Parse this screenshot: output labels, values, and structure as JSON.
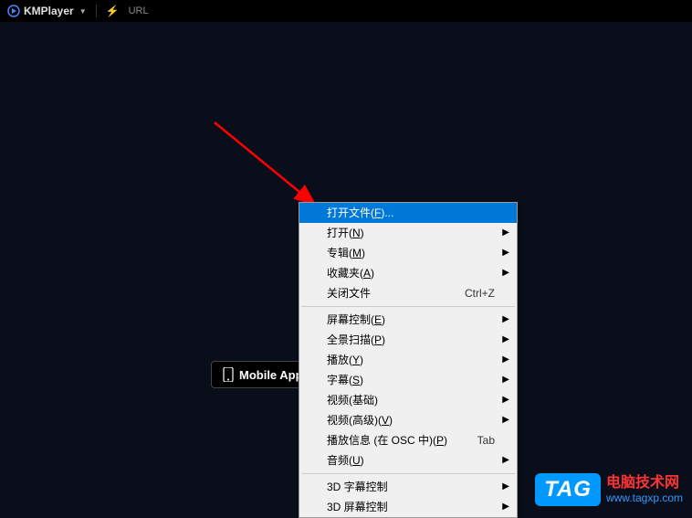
{
  "titlebar": {
    "app_name": "KMPlayer",
    "url_label": "URL"
  },
  "mobile_app_button": {
    "label": "Mobile App"
  },
  "context_menu": {
    "items": [
      {
        "label_pre": "打开文件(",
        "mnemonic": "F",
        "label_post": ")...",
        "type": "item",
        "highlighted": true
      },
      {
        "label_pre": "打开(",
        "mnemonic": "N",
        "label_post": ")",
        "type": "submenu"
      },
      {
        "label_pre": "专辑(",
        "mnemonic": "M",
        "label_post": ")",
        "type": "submenu"
      },
      {
        "label_pre": "收藏夹(",
        "mnemonic": "A",
        "label_post": ")",
        "type": "submenu"
      },
      {
        "label_pre": "关闭文件",
        "mnemonic": "",
        "label_post": "",
        "type": "item",
        "shortcut": "Ctrl+Z"
      },
      {
        "type": "separator"
      },
      {
        "label_pre": "屏幕控制(",
        "mnemonic": "E",
        "label_post": ")",
        "type": "submenu"
      },
      {
        "label_pre": "全景扫描(",
        "mnemonic": "P",
        "label_post": ")",
        "type": "submenu"
      },
      {
        "label_pre": "播放(",
        "mnemonic": "Y",
        "label_post": ")",
        "type": "submenu"
      },
      {
        "label_pre": "字幕(",
        "mnemonic": "S",
        "label_post": ")",
        "type": "submenu"
      },
      {
        "label_pre": "视频(基础)",
        "mnemonic": "",
        "label_post": "",
        "type": "submenu"
      },
      {
        "label_pre": "视频(高级)(",
        "mnemonic": "V",
        "label_post": ")",
        "type": "submenu"
      },
      {
        "label_pre": "播放信息 (在 OSC 中)(",
        "mnemonic": "P",
        "label_post": ")",
        "type": "item",
        "shortcut": "Tab"
      },
      {
        "label_pre": "音频(",
        "mnemonic": "U",
        "label_post": ")",
        "type": "submenu"
      },
      {
        "type": "separator"
      },
      {
        "label_pre": "3D 字幕控制",
        "mnemonic": "",
        "label_post": "",
        "type": "submenu"
      },
      {
        "label_pre": "3D 屏幕控制",
        "mnemonic": "",
        "label_post": "",
        "type": "submenu"
      }
    ]
  },
  "watermark": {
    "badge": "TAG",
    "title": "电脑技术网",
    "url": "www.tagxp.com"
  }
}
